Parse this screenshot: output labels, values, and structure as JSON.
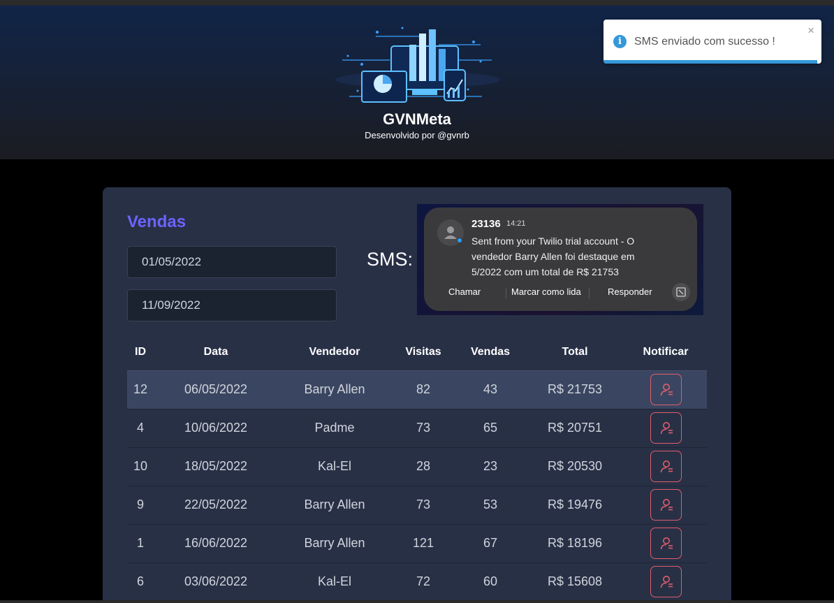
{
  "header": {
    "brand": "GVNMeta",
    "byline": "Desenvolvido por @gvnrb",
    "logo_icon": "analytics-dashboard-illustration"
  },
  "toast": {
    "icon": "info-icon",
    "message": "SMS enviado com sucesso !",
    "close_label": "×",
    "accent": "#3498db"
  },
  "sales": {
    "title": "Vendas",
    "title_color": "#6c63ff",
    "min_date": "01/05/2022",
    "max_date": "11/09/2022",
    "sms_label": "SMS:",
    "sms_preview": {
      "sender": "23136",
      "time": "14:21",
      "body": "Sent from your Twilio trial account - O vendedor Barry Allen foi destaque em 5/2022 com um total de R$ 21753",
      "actions": [
        "Chamar",
        "Marcar como lida",
        "Responder"
      ]
    },
    "columns": [
      "ID",
      "Data",
      "Vendedor",
      "Visitas",
      "Vendas",
      "Total",
      "Notificar"
    ],
    "rows": [
      {
        "id": "12",
        "date": "06/05/2022",
        "seller": "Barry Allen",
        "visits": "82",
        "deals": "43",
        "total": "R$ 21753"
      },
      {
        "id": "4",
        "date": "10/06/2022",
        "seller": "Padme",
        "visits": "73",
        "deals": "65",
        "total": "R$ 20751"
      },
      {
        "id": "10",
        "date": "18/05/2022",
        "seller": "Kal-El",
        "visits": "28",
        "deals": "23",
        "total": "R$ 20530"
      },
      {
        "id": "9",
        "date": "22/05/2022",
        "seller": "Barry Allen",
        "visits": "73",
        "deals": "53",
        "total": "R$ 19476"
      },
      {
        "id": "1",
        "date": "16/06/2022",
        "seller": "Barry Allen",
        "visits": "121",
        "deals": "67",
        "total": "R$ 18196"
      },
      {
        "id": "6",
        "date": "03/06/2022",
        "seller": "Kal-El",
        "visits": "72",
        "deals": "60",
        "total": "R$ 15608"
      }
    ],
    "notify_icon": "user-notify-icon",
    "notify_color": "#e05d6a"
  }
}
